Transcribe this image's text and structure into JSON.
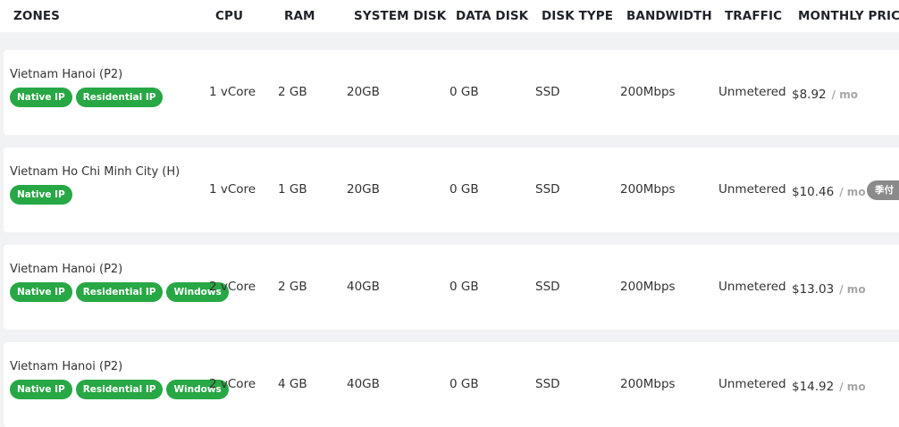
{
  "headers": {
    "zones": "ZONES",
    "cpu": "CPU",
    "ram": "RAM",
    "system_disk": "SYSTEM DISK",
    "data_disk": "DATA DISK",
    "disk_type": "DISK TYPE",
    "bandwidth": "BANDWIDTH",
    "traffic": "TRAFFIC",
    "monthly_price": "MONTHLY PRICE"
  },
  "rows": [
    {
      "zone": "Vietnam Hanoi (P2)",
      "tags": [
        "Native IP",
        "Residential IP"
      ],
      "cpu": "1 vCore",
      "ram": "2 GB",
      "system_disk": "20GB",
      "data_disk": "0 GB",
      "disk_type": "SSD",
      "bandwidth": "200Mbps",
      "traffic": "Unmetered",
      "price": "$8.92",
      "per": "/ mo"
    },
    {
      "zone": "Vietnam Ho Chi Minh City (H)",
      "tags": [
        "Native IP"
      ],
      "cpu": "1 vCore",
      "ram": "1 GB",
      "system_disk": "20GB",
      "data_disk": "0 GB",
      "disk_type": "SSD",
      "bandwidth": "200Mbps",
      "traffic": "Unmetered",
      "price": "$10.46",
      "per": "/ mo",
      "badge": "季付"
    },
    {
      "zone": "Vietnam Hanoi (P2)",
      "tags": [
        "Native IP",
        "Residential IP",
        "Windows"
      ],
      "cpu": "2 vCore",
      "ram": "2 GB",
      "system_disk": "40GB",
      "data_disk": "0 GB",
      "disk_type": "SSD",
      "bandwidth": "200Mbps",
      "traffic": "Unmetered",
      "price": "$13.03",
      "per": "/ mo"
    },
    {
      "zone": "Vietnam Hanoi (P2)",
      "tags": [
        "Native IP",
        "Residential IP",
        "Windows"
      ],
      "cpu": "2 vCore",
      "ram": "4 GB",
      "system_disk": "40GB",
      "data_disk": "0 GB",
      "disk_type": "SSD",
      "bandwidth": "200Mbps",
      "traffic": "Unmetered",
      "price": "$14.92",
      "per": "/ mo"
    }
  ],
  "colors": {
    "tag_green": "#28a745",
    "badge_gray": "#8a8a8a",
    "per_gray": "#a6a6a6"
  }
}
